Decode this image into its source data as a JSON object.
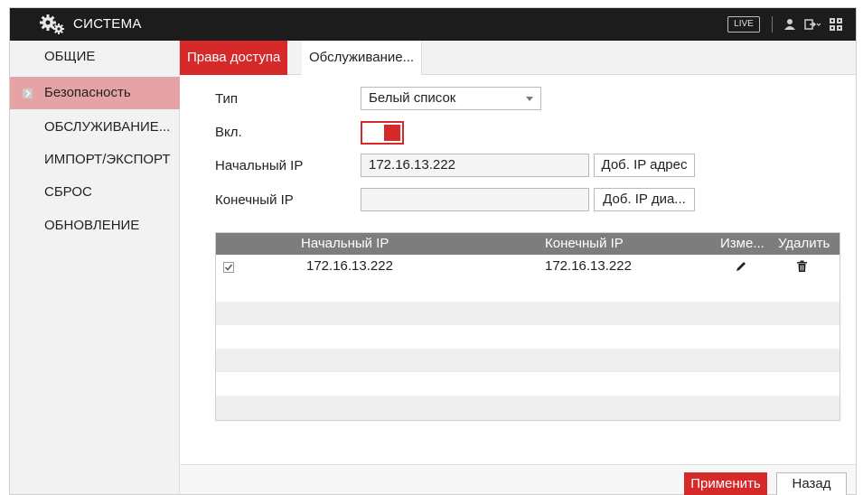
{
  "topbar": {
    "title": "СИСТЕМА",
    "live_label": "LIVE",
    "icons": [
      "gear-icon",
      "user-icon",
      "logout-icon",
      "grid-icon"
    ]
  },
  "sidebar": {
    "items": [
      {
        "label": "ОБЩИЕ"
      },
      {
        "label": "Безопасность",
        "active": true
      },
      {
        "label": "ОБСЛУЖИВАНИЕ..."
      },
      {
        "label": "ИМПОРТ/ЭКСПОРТ"
      },
      {
        "label": "СБРОС"
      },
      {
        "label": "ОБНОВЛЕНИЕ"
      }
    ]
  },
  "tabs": [
    {
      "label": "Права доступа",
      "active": true
    },
    {
      "label": "Обслуживание..."
    }
  ],
  "form": {
    "type_label": "Тип",
    "type_value": "Белый список",
    "enable_label": "Вкл.",
    "enable_on": true,
    "start_ip_label": "Начальный IP",
    "start_ip_value": "172.16.13.222",
    "add_ip_button": "Доб. IP адрес",
    "end_ip_label": "Конечный IP",
    "end_ip_value": "",
    "add_range_button": "Доб. IP диа..."
  },
  "table": {
    "headers": [
      "Начальный IP",
      "Конечный IP",
      "Изме...",
      "Удалить"
    ],
    "rows": [
      {
        "checked": true,
        "start_ip": "172.16.13.222",
        "end_ip": "172.16.13.222"
      }
    ]
  },
  "footer": {
    "apply_label": "Применить",
    "back_label": "Назад"
  },
  "colors": {
    "accent": "#d5292a",
    "active_sidebar": "#e6a3a5",
    "topbar": "#1c1c1c",
    "table_header": "#7d7d7d"
  }
}
